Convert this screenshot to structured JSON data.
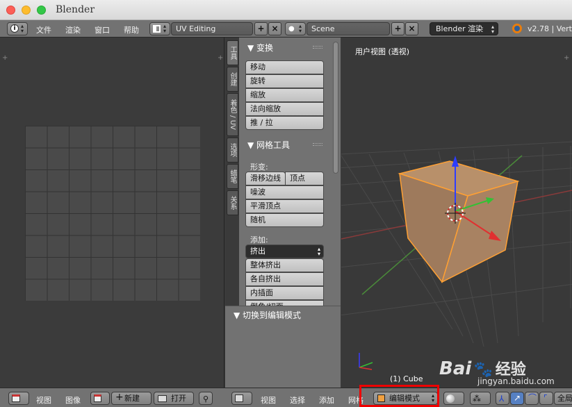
{
  "window": {
    "title": "Blender"
  },
  "topbar": {
    "menus": [
      "文件",
      "渲染",
      "窗口",
      "帮助"
    ],
    "layout": "UV Editing",
    "scene": "Scene",
    "engine": "Blender 渲染",
    "version": "v2.78 | Vert"
  },
  "tool_tabs": [
    "工具",
    "创建",
    "着色 / UV",
    "选项",
    "蜡笔",
    "关系"
  ],
  "transform_panel": {
    "title": "▼ 变换",
    "buttons": [
      "移动",
      "旋转",
      "缩放",
      "法向缩放",
      "推 / 拉"
    ]
  },
  "mesh_panel": {
    "title": "▼ 网格工具",
    "deform_label": "形变:",
    "slide_edge": "滑移边线",
    "vertex": "顶点",
    "deform_buttons": [
      "噪波",
      "平滑顶点",
      "随机"
    ],
    "add_label": "添加:",
    "extrude": "挤出",
    "add_buttons": [
      "整体挤出",
      "各自挤出",
      "内插面",
      "倒角/切面"
    ]
  },
  "operator_panel": {
    "title": "▼ 切换到编辑模式"
  },
  "viewport": {
    "label": "用户视图 (透视)",
    "object": "(1) Cube"
  },
  "uv_header": {
    "menus": [
      "视图",
      "图像"
    ],
    "new": "新建",
    "open": "打开"
  },
  "view3d_header": {
    "menus": [
      "视图",
      "选择",
      "添加",
      "网格"
    ],
    "mode": "编辑模式",
    "global": "全局"
  },
  "watermark": {
    "brand": "Bai",
    "brand2": "百度",
    "jingyan": "经验",
    "url": "jingyan.baidu.com"
  }
}
